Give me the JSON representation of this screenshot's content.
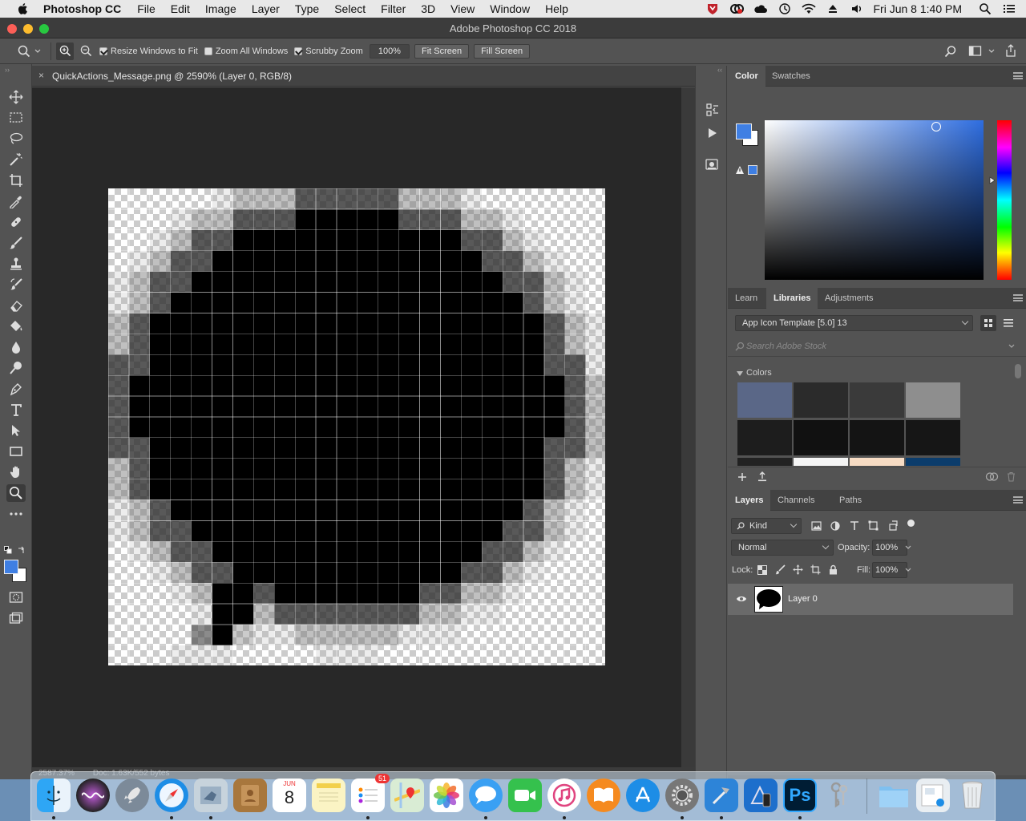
{
  "menubar": {
    "app_name": "Photoshop CC",
    "items": [
      "File",
      "Edit",
      "Image",
      "Layer",
      "Type",
      "Select",
      "Filter",
      "3D",
      "View",
      "Window",
      "Help"
    ],
    "clock": "Fri Jun 8  1:40 PM"
  },
  "window": {
    "title": "Adobe Photoshop CC 2018"
  },
  "options_bar": {
    "resize_windows_label": "Resize Windows to Fit",
    "zoom_all_label": "Zoom All Windows",
    "scrubby_label": "Scrubby Zoom",
    "zoom_value": "100%",
    "fit_screen": "Fit Screen",
    "fill_screen": "Fill Screen"
  },
  "document": {
    "tab_name": "QuickActions_Message.png @ 2590% (Layer 0, RGB/8)",
    "close_glyph": "×",
    "status_zoom": "2587.37%",
    "status_doc": "Doc: 1.63K/552 bytes"
  },
  "color_panel": {
    "tabs": [
      "Color",
      "Swatches"
    ],
    "foreground_color": "#3f7fe3",
    "background_color": "#ffffff"
  },
  "libraries_panel": {
    "tabs": [
      "Learn",
      "Libraries",
      "Adjustments"
    ],
    "library_name": "App Icon Template [5.0] 13",
    "search_placeholder": "Search Adobe Stock",
    "colors_heading": "Colors",
    "swatches": [
      "#5a6787",
      "#2b2b2b",
      "#3a3a3a",
      "#8e8e8e",
      "#1d1d1d",
      "#111111",
      "#141414",
      "#161616",
      "#222222",
      "#f4f4f4",
      "#f7dcc4",
      "#0b3c6b"
    ]
  },
  "layers_panel": {
    "tabs": [
      "Layers",
      "Channels",
      "Paths"
    ],
    "filter_kind": "Kind",
    "blend_mode": "Normal",
    "opacity_label": "Opacity:",
    "opacity_value": "100%",
    "lock_label": "Lock:",
    "fill_label": "Fill:",
    "fill_value": "100%",
    "layer_name": "Layer 0"
  },
  "dock": {
    "calendar_month": "JUN",
    "calendar_day": "8",
    "reminders_badge": "51",
    "photoshop_label": "Ps"
  }
}
